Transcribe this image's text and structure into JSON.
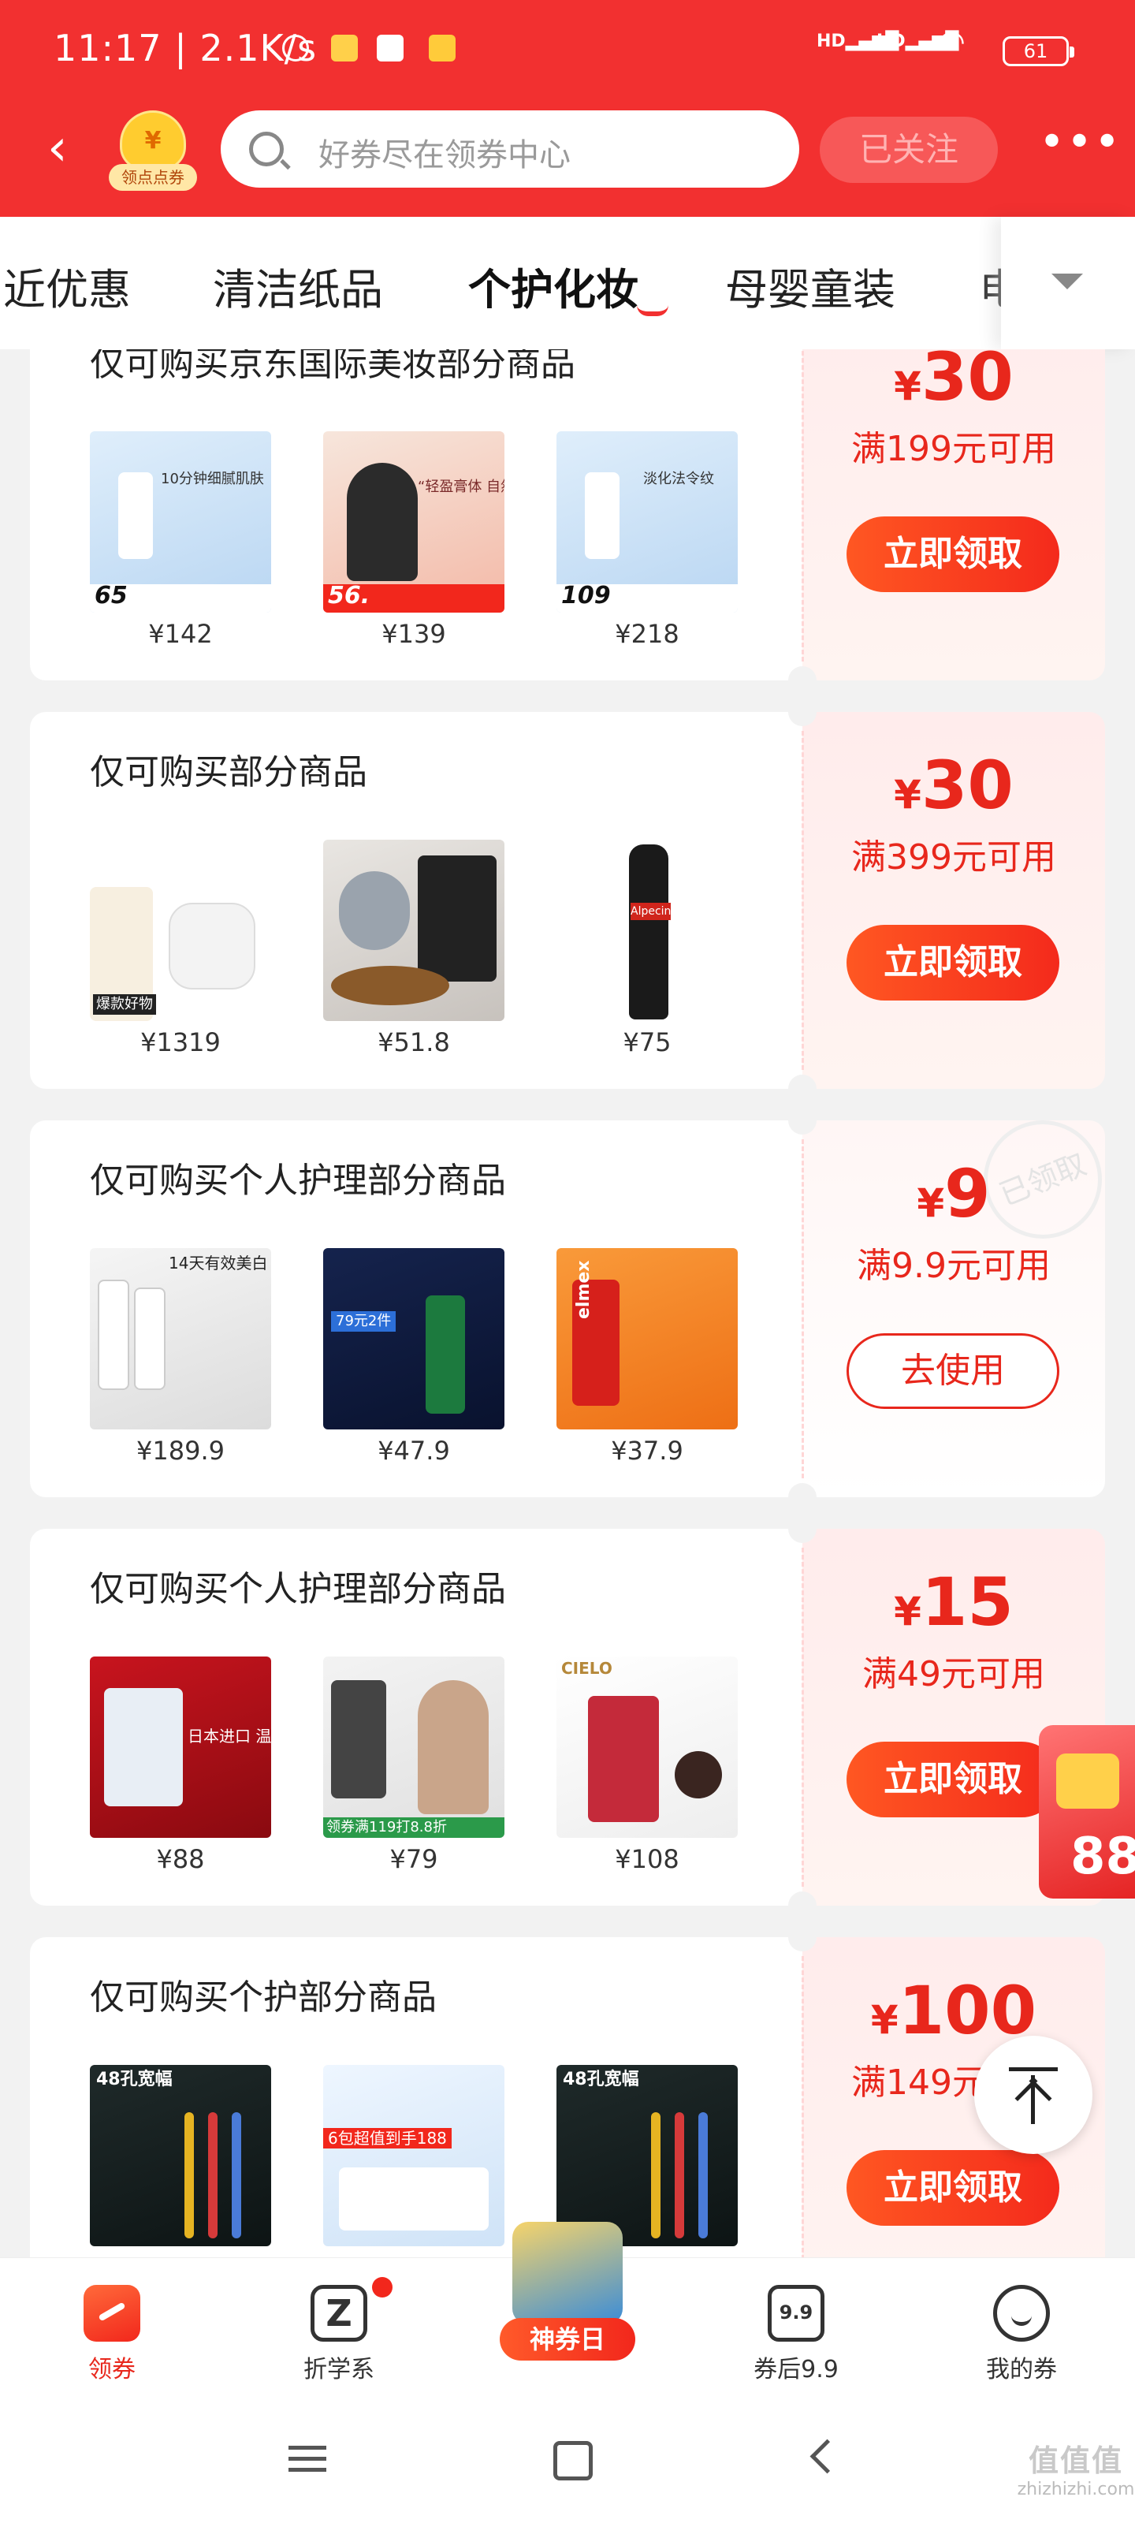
{
  "status_bar": {
    "time": "11:17",
    "speed": "2.1K/s",
    "signal1": "HD",
    "signal2": "HD",
    "battery": "61"
  },
  "header": {
    "badge_label": "领点点券",
    "badge_coin": "¥",
    "search_placeholder": "好券尽在领券中心",
    "follow_label": "已关注",
    "more_label": "•••"
  },
  "tabs": [
    {
      "label": "近优惠"
    },
    {
      "label": "清洁纸品"
    },
    {
      "label": "个护化妆",
      "active": true
    },
    {
      "label": "母婴童装"
    },
    {
      "label": "电"
    }
  ],
  "coupons": [
    {
      "title": "仅可购买京东国际美妆部分商品",
      "amount": "30",
      "condition": "满199元可用",
      "button": "立即领取",
      "products": [
        {
          "price": "¥142",
          "img_text": "10分钟细腻肌肤",
          "big": "65"
        },
        {
          "price": "¥139",
          "img_text": "“轻盈膏体 自然卷曲”",
          "big": "56."
        },
        {
          "price": "¥218",
          "img_text": "淡化法令纹",
          "big": "109"
        }
      ]
    },
    {
      "title": "仅可购买部分商品",
      "amount": "30",
      "condition": "满399元可用",
      "button": "立即领取",
      "products": [
        {
          "price": "¥1319",
          "img_text": "爆款好物"
        },
        {
          "price": "¥51.8",
          "img_text": ""
        },
        {
          "price": "¥75",
          "img_text": "Alpecin"
        }
      ]
    },
    {
      "title": "仅可购买个人护理部分商品",
      "amount": "9",
      "condition": "满9.9元可用",
      "button": "去使用",
      "stamp": "已领取",
      "products": [
        {
          "price": "¥189.9",
          "img_text": "14天有效美白"
        },
        {
          "price": "¥47.9",
          "img_text": "79元2件"
        },
        {
          "price": "¥37.9",
          "img_text": "elmex"
        }
      ]
    },
    {
      "title": "仅可购买个人护理部分商品",
      "amount": "15",
      "condition": "满49元可用",
      "button": "立即领取",
      "products": [
        {
          "price": "¥88",
          "img_text": "日本进口 温和遮白"
        },
        {
          "price": "¥79",
          "img_text": "领券满119打8.8折"
        },
        {
          "price": "¥108",
          "img_text": "CIELO"
        }
      ]
    },
    {
      "title": "仅可购买个护部分商品",
      "amount": "100",
      "condition": "满149元可用",
      "button": "立即领取",
      "products": [
        {
          "price": "",
          "img_text": "48孔宽幅"
        },
        {
          "price": "",
          "img_text": "6包超值到手188"
        },
        {
          "price": "",
          "img_text": "48孔宽幅"
        }
      ]
    }
  ],
  "floating": {
    "red_packet": "88"
  },
  "bottom_nav": [
    {
      "label": "领券",
      "active": true
    },
    {
      "label": "折学系"
    },
    {
      "label": "神券日"
    },
    {
      "label": "券后9.9"
    },
    {
      "label": "我的券"
    }
  ],
  "watermark": {
    "brand": "值值值",
    "url": "zhizhizhi.com"
  }
}
